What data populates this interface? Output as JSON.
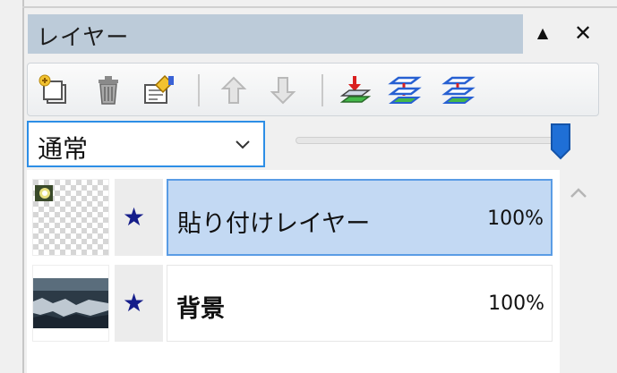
{
  "panel": {
    "title": "レイヤー",
    "pin_glyph": "▲",
    "close_glyph": "✕"
  },
  "toolbar": {
    "icons": [
      "new-layer-icon",
      "trash-icon",
      "layer-properties-icon",
      "arrow-up-icon",
      "arrow-down-icon",
      "merge-down-icon",
      "layer-transform-icon",
      "layer-flatten-icon"
    ]
  },
  "blend": {
    "value": "通常"
  },
  "opacity_slider": {
    "value_percent": 100
  },
  "layers": [
    {
      "name": "貼り付けレイヤー",
      "opacity": "100%",
      "visible_glyph": "★",
      "selected": true
    },
    {
      "name": "背景",
      "opacity": "100%",
      "visible_glyph": "★",
      "selected": false
    }
  ],
  "colors": {
    "accent": "#2d8ee6",
    "selection": "#c3d9f3",
    "titlebar": "#bccbd9",
    "star": "#151d8a"
  }
}
